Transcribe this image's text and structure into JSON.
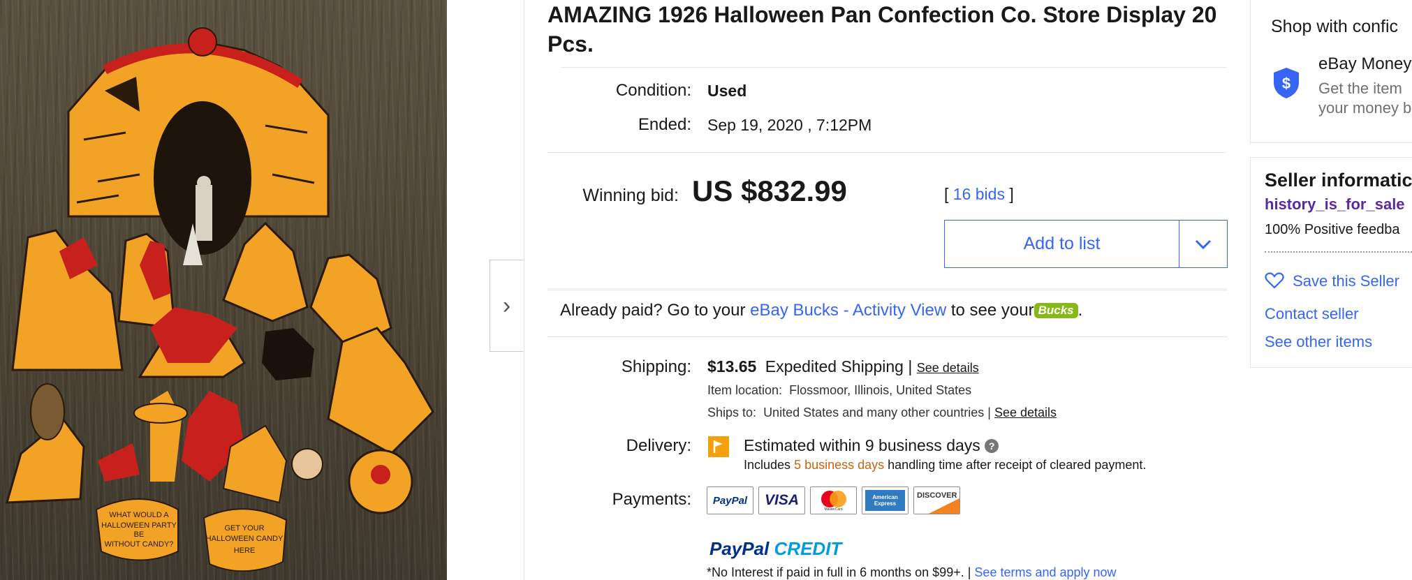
{
  "listing": {
    "title": "AMAZING 1926 Halloween Pan Confection Co. Store Display 20 Pcs.",
    "condition_label": "Condition:",
    "condition_value": "Used",
    "ended_label": "Ended:",
    "ended_value": "Sep 19, 2020 , 7:12PM",
    "winning_bid_label": "Winning bid:",
    "winning_bid_value": "US $832.99",
    "bids_open": "[",
    "bids_link": "16 bids",
    "bids_close": "]",
    "add_to_list": "Add to list"
  },
  "image_texts": {
    "sign_left": [
      "WHAT WOULD A",
      "HALLOWEEN PARTY",
      "BE",
      "WITHOUT CANDY?"
    ],
    "sign_right": [
      "GET YOUR",
      "HALLOWEEN CANDY",
      "HERE"
    ]
  },
  "paid": {
    "prefix": "Already paid? Go to your",
    "link": "eBay Bucks - Activity View",
    "suffix": "to see your",
    "badge": "Bucks",
    "end": "."
  },
  "shipping": {
    "label": "Shipping:",
    "cost": "$13.65",
    "method": "Expedited Shipping |",
    "details_link": "See details",
    "location_label": "Item location:",
    "location_value": "Flossmoor, Illinois, United States",
    "ships_to_label": "Ships to:",
    "ships_to_value": "United States and many other countries |",
    "ships_to_link": "See details"
  },
  "delivery": {
    "label": "Delivery:",
    "estimate": "Estimated within 9 business days",
    "includes_prefix": "Includes",
    "includes_days": "5 business days",
    "includes_suffix": "handling time after receipt of cleared payment."
  },
  "payments": {
    "label": "Payments:",
    "methods": [
      "PayPal",
      "VISA",
      "MasterCard",
      "American Express",
      "DISCOVER"
    ],
    "credit_brand_a": "PayPal",
    "credit_brand_b": "CREDIT",
    "note": "*No Interest if paid in full in 6 months on $99+. |",
    "terms_link": "See terms and apply now"
  },
  "right_panel": {
    "shop_title": "Shop with confic",
    "money_title": "eBay Money",
    "money_line1": "Get the item",
    "money_line2": "your money b",
    "seller_title": "Seller informatic",
    "seller_name": "history_is_for_sale",
    "feedback": "100% Positive feedba",
    "save_seller": "Save this Seller",
    "contact": "Contact seller",
    "other_items": "See other items"
  },
  "colors": {
    "link": "#3665f3",
    "seller_link": "#5b2a9a",
    "shield": "#3665f3",
    "bucks": "#86b817",
    "flag": "#f5a00d",
    "handling_days": "#c7640c"
  },
  "icons": {
    "gallery_next": "chevron-right-icon",
    "add_list_menu": "chevron-down-icon",
    "guarantee": "shield-dollar-icon",
    "delivery": "flag-icon",
    "help": "question-icon",
    "save_seller": "heart-icon"
  }
}
